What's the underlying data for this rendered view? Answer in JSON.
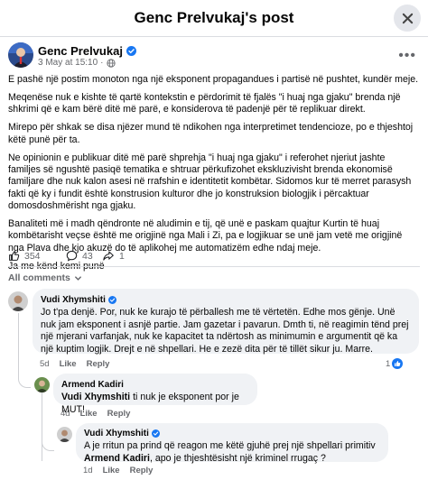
{
  "dialog": {
    "title": "Genc Prelvukaj's post"
  },
  "post": {
    "author": "Genc Prelvukaj",
    "timestamp": "3 May at 15:10",
    "paragraphs": [
      "E pashë një postim monoton nga një eksponent propagandues i partisë në pushtet, kundër meje.",
      "Meqenëse nuk e kishte të qartë kontekstin e përdorimit të fjalës \"i huaj nga gjaku\" brenda një shkrimi që e kam bërë ditë më parë, e konsiderova të padenjë për të replikuar direkt.",
      "Mirepo për shkak se disa njëzer mund të ndikohen nga interpretimet tendencioze, po e thjeshtoj këtë punë për ta.",
      "Ne opinionin e publikuar ditë më parë shprehja \"i huaj nga gjaku\" i referohet njeriut jashte familjes së ngushtë pasiqë tematika e shtruar përkufizohet ekskluzivisht brenda ekonomisë familjare dhe nuk kalon asesi në rrafshin e identitetit kombëtar. Sidomos kur të merret parasysh fakti që ky i fundit është konstrusion kulturor dhe jo konstruksion biologjik i përcaktuar domosdoshmërisht nga gjaku.",
      "Banaliteti më i madh qëndronte në aludimin e tij, që unë e paskam quajtur Kurtin të huaj kombëtarisht veçse është me origjinë nga Mali i Zi, pa e logjikuar se unë jam vetë me origjinë nga Plava dhe kjo akuzë do të aplikohej me automatizëm edhe ndaj meje.",
      "Ja me kënd kemi punë"
    ],
    "reactions": {
      "count": "354",
      "comments": "43",
      "shares": "1"
    }
  },
  "comments_filter": "All comments",
  "comments": [
    {
      "author": "Vudi Xhymshiti",
      "text": "Jo t'pa denjë. Por, nuk ke kurajo të përballesh me të vërtetën. Edhe mos gënje. Unë nuk jam eksponent i asnjë partie. Jam gazetar i pavarun. Dmth ti, në reagimin tënd prej një mjerani varfanjak, nuk ke kapacitet ta ndërtosh as minimumin e argumentit që ka një kuptim logjik. Drejt e në shpellari. He e zezë dita për të tillët sikur ju. Marre.",
      "time": "5d",
      "like": "Like",
      "reply": "Reply",
      "likes": "1"
    },
    {
      "author": "Armend Kadiri",
      "mention": "Vudi Xhymshiti",
      "text": " ti nuk je eksponent por je MUT!",
      "time": "4d",
      "like": "Like",
      "reply": "Reply"
    },
    {
      "author": "Vudi Xhymshiti",
      "text_before": "A je rritun pa prind që reagon me këtë gjuhë prej një shpellari primitiv ",
      "mention": "Armend Kadiri",
      "text_after": ", apo je thjeshtësisht një kriminel rrugaç ?",
      "time": "1d",
      "like": "Like",
      "reply": "Reply"
    }
  ],
  "colors": {
    "accent": "#1877f2",
    "muted": "#65676b",
    "bubble": "#f0f2f5"
  }
}
